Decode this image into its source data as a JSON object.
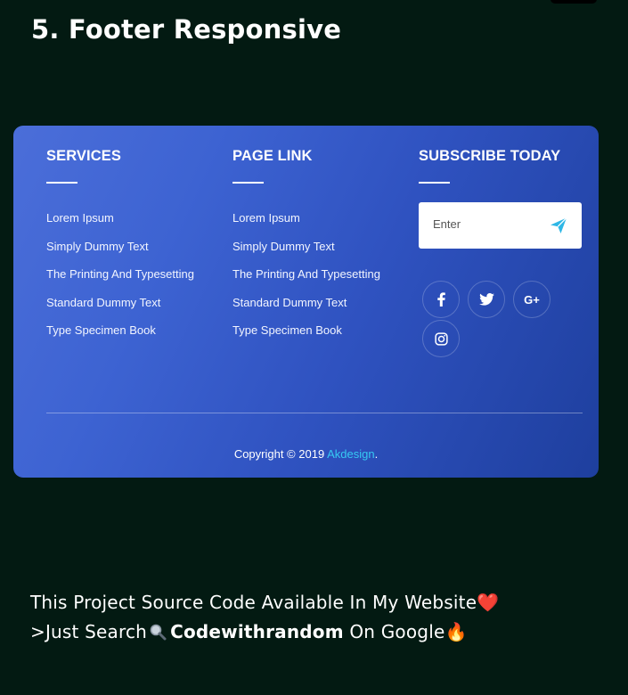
{
  "page_title": "5. Footer Responsive",
  "footer": {
    "services": {
      "heading": "SERVICES",
      "links": [
        "Lorem Ipsum",
        "Simply Dummy Text",
        "The Printing And Typesetting",
        "Standard Dummy Text",
        "Type Specimen Book"
      ]
    },
    "page_link": {
      "heading": "PAGE LINK",
      "links": [
        "Lorem Ipsum",
        "Simply Dummy Text",
        "The Printing And Typesetting",
        "Standard Dummy Text",
        "Type Specimen Book"
      ]
    },
    "subscribe": {
      "heading": "SUBSCRIBE TODAY",
      "placeholder": "Enter",
      "send_icon": "paper-plane-icon"
    },
    "social": {
      "icons": [
        "facebook-icon",
        "twitter-icon",
        "google-plus-icon",
        "instagram-icon"
      ],
      "google_plus_label": "G+"
    },
    "copyright": {
      "prefix": "Copyright © 2019 ",
      "brand": "Akdesign",
      "suffix": "."
    }
  },
  "promo": {
    "line1_text": "This Project Source Code Available In My Website",
    "line1_emoji": "❤️",
    "line2_prefix": ">Just Search",
    "line2_brand": "Codewithrandom",
    "line2_suffix": " On Google",
    "line2_emoji": "🔥"
  },
  "colors": {
    "page_background": "#031a12",
    "card_gradient_start": "#4b6ed9",
    "card_gradient_end": "#1e3f9e",
    "accent_link": "#36c9f2",
    "send_icon": "#2eb7e6"
  }
}
